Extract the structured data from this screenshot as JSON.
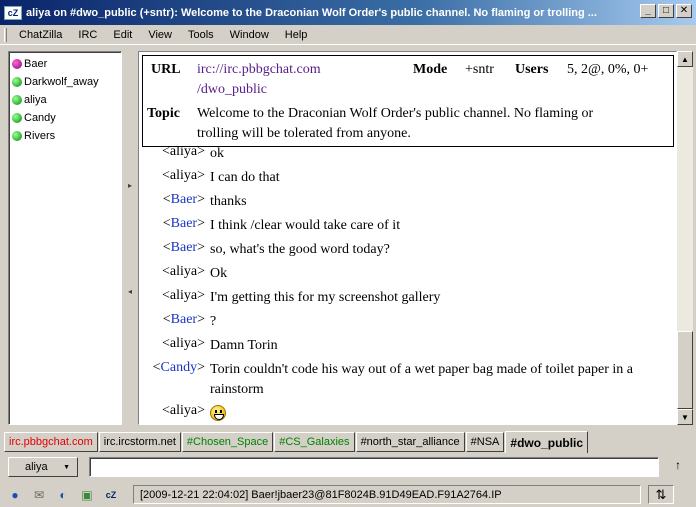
{
  "window": {
    "app_icon": "cZ",
    "title": "aliya on #dwo_public (+sntr): Welcome to the Draconian Wolf Order's public channel. No flaming or trolling ...",
    "minimize": "_",
    "maximize": "□",
    "close": "✕"
  },
  "menu": [
    "ChatZilla",
    "IRC",
    "Edit",
    "View",
    "Tools",
    "Window",
    "Help"
  ],
  "users": [
    {
      "name": "Baer",
      "status": "op"
    },
    {
      "name": "Darkwolf_away",
      "status": "normal"
    },
    {
      "name": "aliya",
      "status": "normal"
    },
    {
      "name": "Candy",
      "status": "normal"
    },
    {
      "name": "Rivers",
      "status": "normal"
    }
  ],
  "channel_header": {
    "url_label": "URL",
    "url_line1": "irc://irc.pbbgchat.com",
    "url_line2": "/dwo_public",
    "mode_label": "Mode",
    "mode_value": "+sntr",
    "users_label": "Users",
    "users_value": "5, 2@, 0%, 0+",
    "topic_label": "Topic",
    "topic_line1": "Welcome to the Draconian Wolf Order's public channel. No flaming or",
    "topic_line2": "trolling will be tolerated from anyone."
  },
  "messages": [
    {
      "nick": "aliya",
      "text": "ok"
    },
    {
      "nick": "aliya",
      "text": "I can do that"
    },
    {
      "nick": "Baer",
      "text": "thanks"
    },
    {
      "nick": "Baer",
      "text": "I think /clear would take care of it"
    },
    {
      "nick": "Baer",
      "text": "so, what's the good word today?"
    },
    {
      "nick": "aliya",
      "text": "Ok"
    },
    {
      "nick": "aliya",
      "text": "I'm getting this for my screenshot gallery"
    },
    {
      "nick": "Baer",
      "text": "?"
    },
    {
      "nick": "aliya",
      "text": "Damn Torin"
    },
    {
      "nick": "Candy",
      "text": "Torin couldn't code his way out of a wet paper bag made of toilet paper in a rainstorm"
    },
    {
      "nick": "aliya",
      "text": ""
    }
  ],
  "tabs": [
    {
      "label": "irc.pbbgchat.com",
      "style": "red"
    },
    {
      "label": "irc.ircstorm.net",
      "style": "normal"
    },
    {
      "label": "#Chosen_Space",
      "style": "green"
    },
    {
      "label": "#CS_Galaxies",
      "style": "green"
    },
    {
      "label": "#north_star_alliance",
      "style": "normal"
    },
    {
      "label": "#NSA",
      "style": "normal"
    },
    {
      "label": "#dwo_public",
      "style": "active"
    }
  ],
  "input": {
    "nick": "aliya",
    "value": ""
  },
  "status": {
    "text": "[2009-12-21 22:04:02] Baer!jbaer23@81F8024B.91D49EAD.F91A2764.IP",
    "icons": [
      "globe-icon",
      "mail-icon",
      "addressbook-icon",
      "composer-icon",
      "chatzilla-icon"
    ]
  }
}
